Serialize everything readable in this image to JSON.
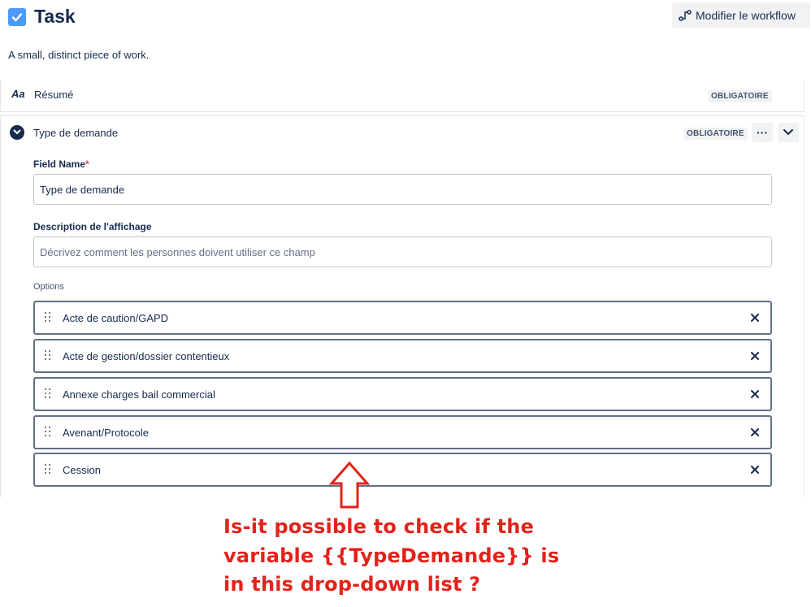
{
  "header": {
    "title": "Task",
    "workflow_button": "Modifier le workflow",
    "description": "A small, distinct piece of work."
  },
  "fields": [
    {
      "icon": "text-aa-icon",
      "icon_text": "Aa",
      "label": "Résumé",
      "badge": "OBLIGATOIRE"
    }
  ],
  "field_editor": {
    "title": "Type de demande",
    "badge": "OBLIGATOIRE",
    "more_label": "···",
    "field_name_label": "Field Name",
    "required_marker": "*",
    "field_name_value": "Type de demande",
    "description_label": "Description de l'affichage",
    "description_placeholder": "Décrivez comment les personnes doivent utiliser ce champ",
    "options_label": "Options",
    "options": [
      "Acte de caution/GAPD",
      "Acte de gestion/dossier contentieux",
      "Annexe charges bail commercial",
      "Avenant/Protocole",
      "Cession"
    ]
  },
  "annotation": {
    "lines": [
      "Is-it possible to check if the",
      "variable {{TypeDemande}} is",
      "in this drop-down list ?"
    ],
    "color": "#e2231a"
  },
  "colors": {
    "task_icon": "#4c9aff",
    "text": "#172b4d",
    "badge_bg": "#f1f2f4"
  }
}
